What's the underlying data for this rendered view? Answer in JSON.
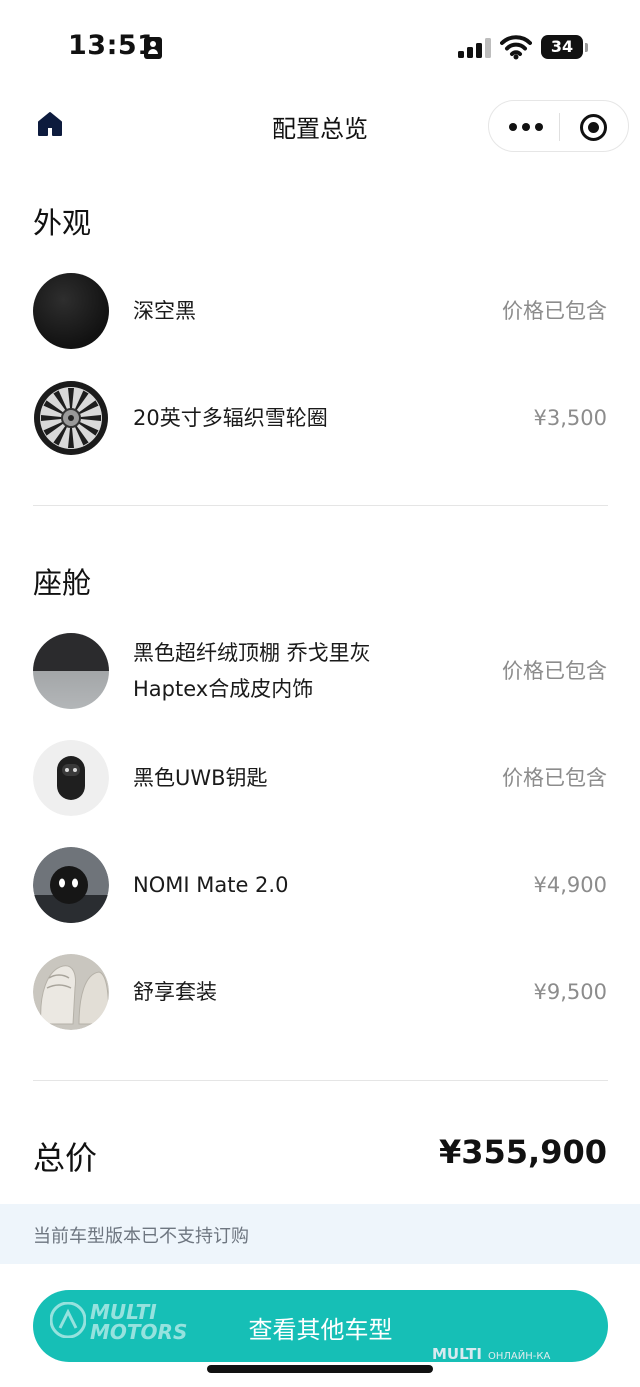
{
  "status_bar": {
    "time": "13:51",
    "battery": "34"
  },
  "nav": {
    "title": "配置总览"
  },
  "exterior": {
    "title": "外观",
    "items": [
      {
        "name": "深空黑",
        "price": "价格已包含",
        "icon": "black-paint-swatch"
      },
      {
        "name": "20英寸多辐织雪轮圈",
        "price": "¥3,500",
        "icon": "wheel-rim"
      }
    ]
  },
  "cabin": {
    "title": "座舱",
    "items": [
      {
        "name_line1": "黑色超纤绒顶棚 乔戈里灰",
        "name_line2": "Haptex合成皮内饰",
        "price": "价格已包含",
        "icon": "interior-trim-swatch"
      },
      {
        "name": "黑色UWB钥匙",
        "price": "价格已包含",
        "icon": "uwb-key"
      },
      {
        "name": "NOMI Mate 2.0",
        "price": "¥4,900",
        "icon": "nomi-mate"
      },
      {
        "name": "舒享套装",
        "price": "¥9,500",
        "icon": "comfort-seat"
      }
    ]
  },
  "total": {
    "label": "总价",
    "value": "¥355,900"
  },
  "notice": "当前车型版本已不支持订购",
  "cta": {
    "label": "查看其他车型"
  },
  "watermark": {
    "left_line1": "MULTI",
    "left_line2": "MOTORS",
    "right": "MULTI",
    "right_sub": "ОНЛАЙН-КА"
  },
  "colors": {
    "accent": "#16bfb6",
    "notice_bg": "#eef5fb",
    "price_gray": "#8c8c8c"
  }
}
